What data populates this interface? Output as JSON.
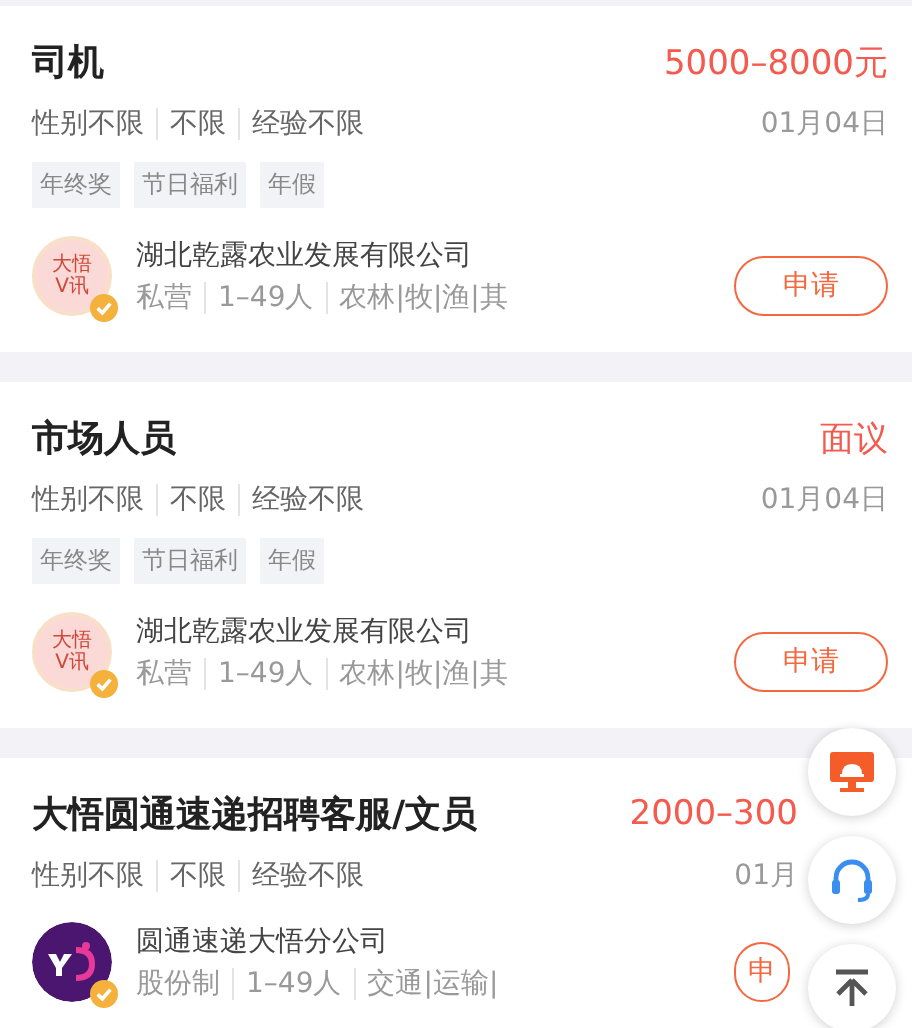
{
  "jobs": [
    {
      "title": "司机",
      "salary": "5000–8000元",
      "requirements": [
        "性别不限",
        "不限",
        "经验不限"
      ],
      "date": "01月04日",
      "tags": [
        "年终奖",
        "节日福利",
        "年假"
      ],
      "company": {
        "name": "湖北乾露农业发展有限公司",
        "kind": "pink",
        "logo_text": "大悟V讯",
        "verified": true,
        "meta": [
          "私营",
          "1–49人",
          "农林|牧|渔|其"
        ]
      },
      "apply": "申请"
    },
    {
      "title": "市场人员",
      "salary": "面议",
      "requirements": [
        "性别不限",
        "不限",
        "经验不限"
      ],
      "date": "01月04日",
      "tags": [
        "年终奖",
        "节日福利",
        "年假"
      ],
      "company": {
        "name": "湖北乾露农业发展有限公司",
        "kind": "pink",
        "logo_text": "大悟V讯",
        "verified": true,
        "meta": [
          "私营",
          "1–49人",
          "农林|牧|渔|其"
        ]
      },
      "apply": "申请"
    },
    {
      "title": "大悟圆通速递招聘客服/文员",
      "salary": "2000–300",
      "requirements": [
        "性别不限",
        "不限",
        "经验不限"
      ],
      "date": "01月",
      "company": {
        "name": "圆通速递大悟分公司",
        "kind": "purple",
        "verified": true,
        "meta": [
          "股份制",
          "1–49人",
          "交通|运输|"
        ]
      },
      "apply": "申"
    }
  ],
  "floating_buttons": [
    {
      "kind": "monitor"
    },
    {
      "kind": "headset"
    },
    {
      "kind": "top"
    }
  ]
}
